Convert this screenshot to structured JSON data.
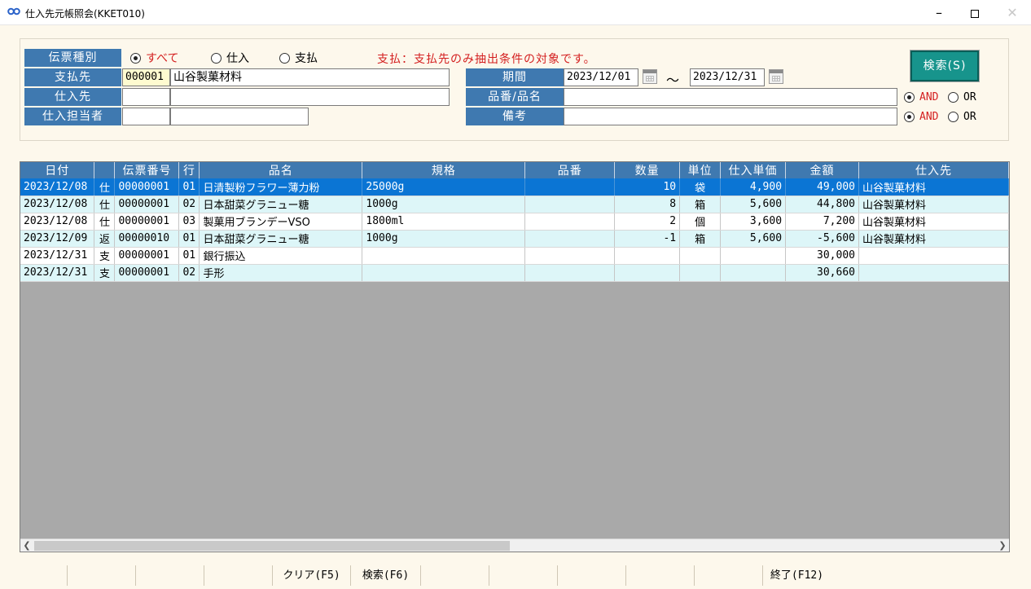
{
  "window": {
    "title": "仕入先元帳照会(KKET010)"
  },
  "conditions": {
    "denpyo_label": "伝票種別",
    "radio_all": "すべて",
    "radio_shiire": "仕入",
    "radio_shiharai": "支払",
    "notice": "支払：支払先のみ抽出条件の対象です。",
    "shiharaisaki_label": "支払先",
    "shiharaisaki_code": "000001",
    "shiharaisaki_name": "山谷製菓材料",
    "shiiresaki_label": "仕入先",
    "shiiresaki_code": "",
    "shiiresaki_name": "",
    "tantousha_label": "仕入担当者",
    "tantousha_code": "",
    "tantousha_name": "",
    "kikan_label": "期間",
    "date_from": "2023/12/01",
    "date_sep": "～",
    "date_to": "2023/12/31",
    "hinban_label": "品番/品名",
    "hinban_value": "",
    "bikou_label": "備考",
    "bikou_value": "",
    "and_label": "AND",
    "or_label": "OR",
    "search_button": "検索(S)"
  },
  "grid": {
    "headers": [
      "日付",
      "",
      "伝票番号",
      "行",
      "品名",
      "規格",
      "品番",
      "数量",
      "単位",
      "仕入単価",
      "金額",
      "仕入先"
    ],
    "rows": [
      [
        "2023/12/08",
        "仕",
        "00000001",
        "01",
        "日清製粉フラワー薄力粉",
        "25000g",
        "",
        "10",
        "袋",
        "4,900",
        "49,000",
        "山谷製菓材料"
      ],
      [
        "2023/12/08",
        "仕",
        "00000001",
        "02",
        "日本甜菜グラニュー糖",
        "1000g",
        "",
        "8",
        "箱",
        "5,600",
        "44,800",
        "山谷製菓材料"
      ],
      [
        "2023/12/08",
        "仕",
        "00000001",
        "03",
        "製菓用ブランデーVSO",
        "1800ml",
        "",
        "2",
        "個",
        "3,600",
        "7,200",
        "山谷製菓材料"
      ],
      [
        "2023/12/09",
        "返",
        "00000010",
        "01",
        "日本甜菜グラニュー糖",
        "1000g",
        "",
        "-1",
        "箱",
        "5,600",
        "-5,600",
        "山谷製菓材料"
      ],
      [
        "2023/12/31",
        "支",
        "00000001",
        "01",
        "銀行振込",
        "",
        "",
        "",
        "",
        "",
        "30,000",
        ""
      ],
      [
        "2023/12/31",
        "支",
        "00000001",
        "02",
        "手形",
        "",
        "",
        "",
        "",
        "",
        "30,660",
        ""
      ]
    ]
  },
  "fkeys": {
    "f5": "クリア(F5)",
    "f6": "検索(F6)",
    "f12": "終了(F12)"
  },
  "colors": {
    "label_bg": "#3f79b0",
    "selected_row": "#0b75d4",
    "alt_row": "#ddf6f8",
    "search_button": "#17948c"
  }
}
